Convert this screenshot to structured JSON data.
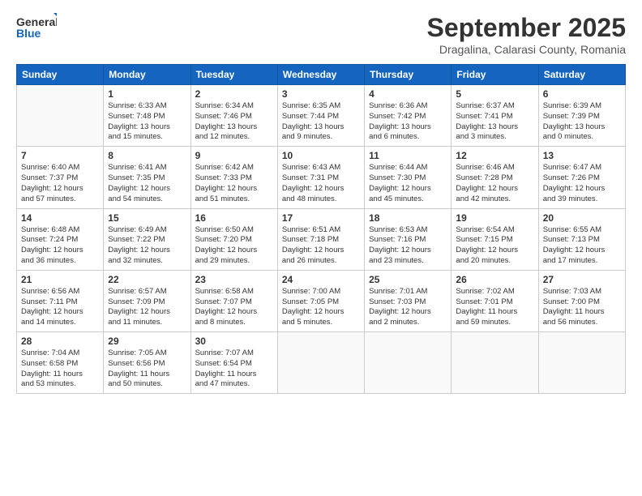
{
  "logo": {
    "line1": "General",
    "line2": "Blue"
  },
  "title": "September 2025",
  "location": "Dragalina, Calarasi County, Romania",
  "weekdays": [
    "Sunday",
    "Monday",
    "Tuesday",
    "Wednesday",
    "Thursday",
    "Friday",
    "Saturday"
  ],
  "weeks": [
    [
      {
        "day": "",
        "text": ""
      },
      {
        "day": "1",
        "text": "Sunrise: 6:33 AM\nSunset: 7:48 PM\nDaylight: 13 hours\nand 15 minutes."
      },
      {
        "day": "2",
        "text": "Sunrise: 6:34 AM\nSunset: 7:46 PM\nDaylight: 13 hours\nand 12 minutes."
      },
      {
        "day": "3",
        "text": "Sunrise: 6:35 AM\nSunset: 7:44 PM\nDaylight: 13 hours\nand 9 minutes."
      },
      {
        "day": "4",
        "text": "Sunrise: 6:36 AM\nSunset: 7:42 PM\nDaylight: 13 hours\nand 6 minutes."
      },
      {
        "day": "5",
        "text": "Sunrise: 6:37 AM\nSunset: 7:41 PM\nDaylight: 13 hours\nand 3 minutes."
      },
      {
        "day": "6",
        "text": "Sunrise: 6:39 AM\nSunset: 7:39 PM\nDaylight: 13 hours\nand 0 minutes."
      }
    ],
    [
      {
        "day": "7",
        "text": "Sunrise: 6:40 AM\nSunset: 7:37 PM\nDaylight: 12 hours\nand 57 minutes."
      },
      {
        "day": "8",
        "text": "Sunrise: 6:41 AM\nSunset: 7:35 PM\nDaylight: 12 hours\nand 54 minutes."
      },
      {
        "day": "9",
        "text": "Sunrise: 6:42 AM\nSunset: 7:33 PM\nDaylight: 12 hours\nand 51 minutes."
      },
      {
        "day": "10",
        "text": "Sunrise: 6:43 AM\nSunset: 7:31 PM\nDaylight: 12 hours\nand 48 minutes."
      },
      {
        "day": "11",
        "text": "Sunrise: 6:44 AM\nSunset: 7:30 PM\nDaylight: 12 hours\nand 45 minutes."
      },
      {
        "day": "12",
        "text": "Sunrise: 6:46 AM\nSunset: 7:28 PM\nDaylight: 12 hours\nand 42 minutes."
      },
      {
        "day": "13",
        "text": "Sunrise: 6:47 AM\nSunset: 7:26 PM\nDaylight: 12 hours\nand 39 minutes."
      }
    ],
    [
      {
        "day": "14",
        "text": "Sunrise: 6:48 AM\nSunset: 7:24 PM\nDaylight: 12 hours\nand 36 minutes."
      },
      {
        "day": "15",
        "text": "Sunrise: 6:49 AM\nSunset: 7:22 PM\nDaylight: 12 hours\nand 32 minutes."
      },
      {
        "day": "16",
        "text": "Sunrise: 6:50 AM\nSunset: 7:20 PM\nDaylight: 12 hours\nand 29 minutes."
      },
      {
        "day": "17",
        "text": "Sunrise: 6:51 AM\nSunset: 7:18 PM\nDaylight: 12 hours\nand 26 minutes."
      },
      {
        "day": "18",
        "text": "Sunrise: 6:53 AM\nSunset: 7:16 PM\nDaylight: 12 hours\nand 23 minutes."
      },
      {
        "day": "19",
        "text": "Sunrise: 6:54 AM\nSunset: 7:15 PM\nDaylight: 12 hours\nand 20 minutes."
      },
      {
        "day": "20",
        "text": "Sunrise: 6:55 AM\nSunset: 7:13 PM\nDaylight: 12 hours\nand 17 minutes."
      }
    ],
    [
      {
        "day": "21",
        "text": "Sunrise: 6:56 AM\nSunset: 7:11 PM\nDaylight: 12 hours\nand 14 minutes."
      },
      {
        "day": "22",
        "text": "Sunrise: 6:57 AM\nSunset: 7:09 PM\nDaylight: 12 hours\nand 11 minutes."
      },
      {
        "day": "23",
        "text": "Sunrise: 6:58 AM\nSunset: 7:07 PM\nDaylight: 12 hours\nand 8 minutes."
      },
      {
        "day": "24",
        "text": "Sunrise: 7:00 AM\nSunset: 7:05 PM\nDaylight: 12 hours\nand 5 minutes."
      },
      {
        "day": "25",
        "text": "Sunrise: 7:01 AM\nSunset: 7:03 PM\nDaylight: 12 hours\nand 2 minutes."
      },
      {
        "day": "26",
        "text": "Sunrise: 7:02 AM\nSunset: 7:01 PM\nDaylight: 11 hours\nand 59 minutes."
      },
      {
        "day": "27",
        "text": "Sunrise: 7:03 AM\nSunset: 7:00 PM\nDaylight: 11 hours\nand 56 minutes."
      }
    ],
    [
      {
        "day": "28",
        "text": "Sunrise: 7:04 AM\nSunset: 6:58 PM\nDaylight: 11 hours\nand 53 minutes."
      },
      {
        "day": "29",
        "text": "Sunrise: 7:05 AM\nSunset: 6:56 PM\nDaylight: 11 hours\nand 50 minutes."
      },
      {
        "day": "30",
        "text": "Sunrise: 7:07 AM\nSunset: 6:54 PM\nDaylight: 11 hours\nand 47 minutes."
      },
      {
        "day": "",
        "text": ""
      },
      {
        "day": "",
        "text": ""
      },
      {
        "day": "",
        "text": ""
      },
      {
        "day": "",
        "text": ""
      }
    ]
  ]
}
